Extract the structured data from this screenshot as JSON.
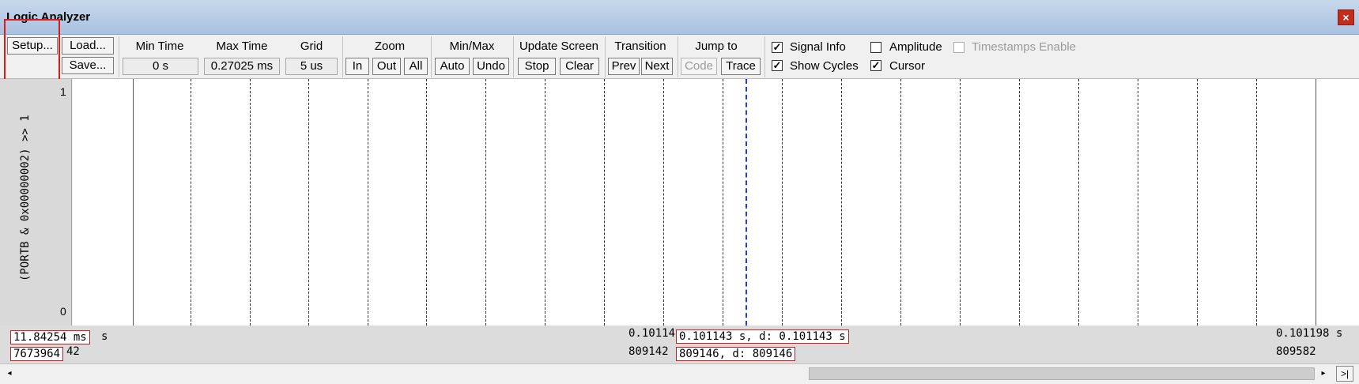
{
  "window": {
    "title": "Logic Analyzer",
    "close_glyph": "×"
  },
  "toolbar": {
    "setup_label": "Setup...",
    "load_label": "Load...",
    "save_label": "Save...",
    "min_time": {
      "label": "Min Time",
      "value": "0 s"
    },
    "max_time": {
      "label": "Max Time",
      "value": "0.27025 ms"
    },
    "grid": {
      "label": "Grid",
      "value": "5 us"
    },
    "zoom": {
      "label": "Zoom",
      "in": "In",
      "out": "Out",
      "all": "All"
    },
    "minmax": {
      "label": "Min/Max",
      "auto": "Auto",
      "undo": "Undo"
    },
    "update_screen": {
      "label": "Update Screen",
      "stop": "Stop",
      "clear": "Clear"
    },
    "transition": {
      "label": "Transition",
      "prev": "Prev",
      "next": "Next"
    },
    "jump_to": {
      "label": "Jump to",
      "code": "Code",
      "trace": "Trace"
    },
    "options": {
      "signal_info": {
        "label": "Signal Info",
        "checked": true
      },
      "amplitude": {
        "label": "Amplitude",
        "checked": false
      },
      "timestamps_enable": {
        "label": "Timestamps Enable",
        "checked": false,
        "enabled": false
      },
      "show_cycles": {
        "label": "Show Cycles",
        "checked": true
      },
      "cursor": {
        "label": "Cursor",
        "checked": true
      }
    }
  },
  "signal": {
    "name": "(PORTB & 0x00000002) >> 1",
    "high": "1",
    "low": "0"
  },
  "status": {
    "left_time_box": "11.84254 ms",
    "left_time_unit": "s",
    "left_cycles_box": "7673964",
    "left_cycles_tail": "42",
    "mid_time": "0.10114",
    "mid_cycles": "809142",
    "cursor_time_box": "0.101143 s,  d: 0.101143 s",
    "cursor_cycles_box": "809146,   d: 809146",
    "right_time": "0.101198 s",
    "right_cycles": "809582"
  },
  "scrollbar": {
    "left_arrow": "◂",
    "right_arrow": "▸",
    "end_label": ">|"
  }
}
